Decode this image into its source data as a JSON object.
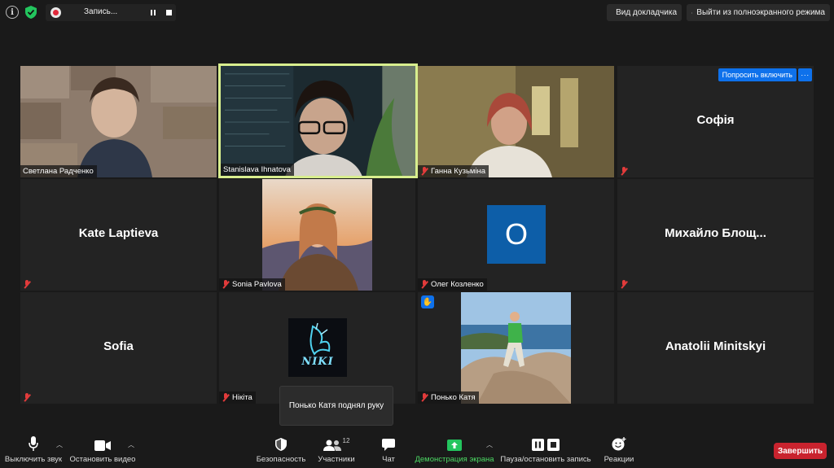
{
  "window": {
    "recording_label": "Запись...",
    "speaker_view_label": "Вид докладчика",
    "exit_fullscreen_label": "Выйти из полноэкранного режима"
  },
  "participants": [
    {
      "name": "Светлана Радченко",
      "muted": false,
      "video": true
    },
    {
      "name": "Stanislava Ihnatova",
      "muted": false,
      "video": true,
      "active_speaker": true
    },
    {
      "name": "Ганна Кузьміна",
      "muted": true,
      "video": true
    },
    {
      "name": "Софія",
      "display_name": "Софія",
      "muted": true,
      "video": false
    },
    {
      "name": "Kate Laptieva",
      "display_name": "Kate Laptieva",
      "muted": true,
      "video": false
    },
    {
      "name": "Sonia Pavlova",
      "muted": true,
      "video": false,
      "avatar": "photo"
    },
    {
      "name": "Олег Козленко",
      "muted": true,
      "video": false,
      "avatar_letter": "О"
    },
    {
      "name": "Михайло Блощ...",
      "display_name": "Михайло  Блощ...",
      "muted": true,
      "video": false
    },
    {
      "name": "Sofia",
      "display_name": "Sofia",
      "muted": true,
      "video": false
    },
    {
      "name": "Нікіта",
      "muted": true,
      "video": false,
      "avatar": "logo",
      "avatar_text": "NIKI"
    },
    {
      "name": "Понько Катя",
      "muted": true,
      "video": false,
      "avatar": "photo",
      "hand_raised": true
    },
    {
      "name": "Anatolii Minitskyi",
      "display_name": "Anatolii Minitskyi",
      "muted": false,
      "video": false
    }
  ],
  "ask_unmute_label": "Попросить включить",
  "more_label": "···",
  "notification": "Понько Катя поднял руку",
  "toolbar": {
    "mute_label": "Выключить звук",
    "video_label": "Остановить видео",
    "security_label": "Безопасность",
    "participants_label": "Участники",
    "participants_count": "12",
    "chat_label": "Чат",
    "share_label": "Демонстрация экрана",
    "record_label": "Пауза/остановить запись",
    "reactions_label": "Реакции",
    "end_label": "Завершить"
  },
  "colors": {
    "accent_blue": "#0e71eb",
    "active_border": "#d8ee8e",
    "end_red": "#c9232e",
    "share_green": "#4cd964",
    "muted_red": "#e23b3b"
  }
}
